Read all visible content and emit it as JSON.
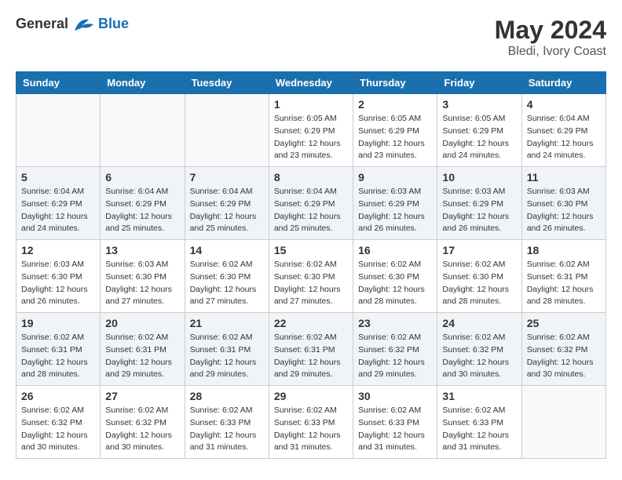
{
  "logo": {
    "text_general": "General",
    "text_blue": "Blue"
  },
  "title": "May 2024",
  "subtitle": "Bledi, Ivory Coast",
  "weekdays": [
    "Sunday",
    "Monday",
    "Tuesday",
    "Wednesday",
    "Thursday",
    "Friday",
    "Saturday"
  ],
  "weeks": [
    [
      {
        "day": "",
        "info": ""
      },
      {
        "day": "",
        "info": ""
      },
      {
        "day": "",
        "info": ""
      },
      {
        "day": "1",
        "info": "Sunrise: 6:05 AM\nSunset: 6:29 PM\nDaylight: 12 hours\nand 23 minutes."
      },
      {
        "day": "2",
        "info": "Sunrise: 6:05 AM\nSunset: 6:29 PM\nDaylight: 12 hours\nand 23 minutes."
      },
      {
        "day": "3",
        "info": "Sunrise: 6:05 AM\nSunset: 6:29 PM\nDaylight: 12 hours\nand 24 minutes."
      },
      {
        "day": "4",
        "info": "Sunrise: 6:04 AM\nSunset: 6:29 PM\nDaylight: 12 hours\nand 24 minutes."
      }
    ],
    [
      {
        "day": "5",
        "info": "Sunrise: 6:04 AM\nSunset: 6:29 PM\nDaylight: 12 hours\nand 24 minutes."
      },
      {
        "day": "6",
        "info": "Sunrise: 6:04 AM\nSunset: 6:29 PM\nDaylight: 12 hours\nand 25 minutes."
      },
      {
        "day": "7",
        "info": "Sunrise: 6:04 AM\nSunset: 6:29 PM\nDaylight: 12 hours\nand 25 minutes."
      },
      {
        "day": "8",
        "info": "Sunrise: 6:04 AM\nSunset: 6:29 PM\nDaylight: 12 hours\nand 25 minutes."
      },
      {
        "day": "9",
        "info": "Sunrise: 6:03 AM\nSunset: 6:29 PM\nDaylight: 12 hours\nand 26 minutes."
      },
      {
        "day": "10",
        "info": "Sunrise: 6:03 AM\nSunset: 6:29 PM\nDaylight: 12 hours\nand 26 minutes."
      },
      {
        "day": "11",
        "info": "Sunrise: 6:03 AM\nSunset: 6:30 PM\nDaylight: 12 hours\nand 26 minutes."
      }
    ],
    [
      {
        "day": "12",
        "info": "Sunrise: 6:03 AM\nSunset: 6:30 PM\nDaylight: 12 hours\nand 26 minutes."
      },
      {
        "day": "13",
        "info": "Sunrise: 6:03 AM\nSunset: 6:30 PM\nDaylight: 12 hours\nand 27 minutes."
      },
      {
        "day": "14",
        "info": "Sunrise: 6:02 AM\nSunset: 6:30 PM\nDaylight: 12 hours\nand 27 minutes."
      },
      {
        "day": "15",
        "info": "Sunrise: 6:02 AM\nSunset: 6:30 PM\nDaylight: 12 hours\nand 27 minutes."
      },
      {
        "day": "16",
        "info": "Sunrise: 6:02 AM\nSunset: 6:30 PM\nDaylight: 12 hours\nand 28 minutes."
      },
      {
        "day": "17",
        "info": "Sunrise: 6:02 AM\nSunset: 6:30 PM\nDaylight: 12 hours\nand 28 minutes."
      },
      {
        "day": "18",
        "info": "Sunrise: 6:02 AM\nSunset: 6:31 PM\nDaylight: 12 hours\nand 28 minutes."
      }
    ],
    [
      {
        "day": "19",
        "info": "Sunrise: 6:02 AM\nSunset: 6:31 PM\nDaylight: 12 hours\nand 28 minutes."
      },
      {
        "day": "20",
        "info": "Sunrise: 6:02 AM\nSunset: 6:31 PM\nDaylight: 12 hours\nand 29 minutes."
      },
      {
        "day": "21",
        "info": "Sunrise: 6:02 AM\nSunset: 6:31 PM\nDaylight: 12 hours\nand 29 minutes."
      },
      {
        "day": "22",
        "info": "Sunrise: 6:02 AM\nSunset: 6:31 PM\nDaylight: 12 hours\nand 29 minutes."
      },
      {
        "day": "23",
        "info": "Sunrise: 6:02 AM\nSunset: 6:32 PM\nDaylight: 12 hours\nand 29 minutes."
      },
      {
        "day": "24",
        "info": "Sunrise: 6:02 AM\nSunset: 6:32 PM\nDaylight: 12 hours\nand 30 minutes."
      },
      {
        "day": "25",
        "info": "Sunrise: 6:02 AM\nSunset: 6:32 PM\nDaylight: 12 hours\nand 30 minutes."
      }
    ],
    [
      {
        "day": "26",
        "info": "Sunrise: 6:02 AM\nSunset: 6:32 PM\nDaylight: 12 hours\nand 30 minutes."
      },
      {
        "day": "27",
        "info": "Sunrise: 6:02 AM\nSunset: 6:32 PM\nDaylight: 12 hours\nand 30 minutes."
      },
      {
        "day": "28",
        "info": "Sunrise: 6:02 AM\nSunset: 6:33 PM\nDaylight: 12 hours\nand 31 minutes."
      },
      {
        "day": "29",
        "info": "Sunrise: 6:02 AM\nSunset: 6:33 PM\nDaylight: 12 hours\nand 31 minutes."
      },
      {
        "day": "30",
        "info": "Sunrise: 6:02 AM\nSunset: 6:33 PM\nDaylight: 12 hours\nand 31 minutes."
      },
      {
        "day": "31",
        "info": "Sunrise: 6:02 AM\nSunset: 6:33 PM\nDaylight: 12 hours\nand 31 minutes."
      },
      {
        "day": "",
        "info": ""
      }
    ]
  ]
}
